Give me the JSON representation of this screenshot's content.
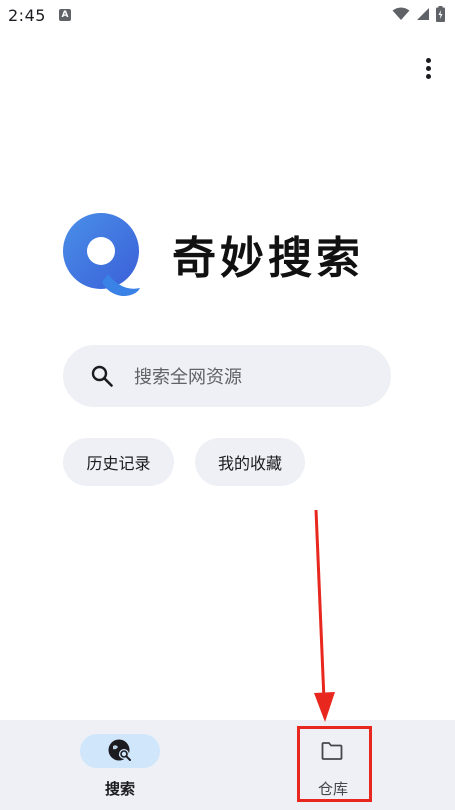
{
  "status_bar": {
    "time": "2:45",
    "notification_icon": "a-letter-icon",
    "icons": [
      "wifi-icon",
      "signal-icon",
      "battery-icon"
    ]
  },
  "header": {
    "menu_icon": "more-vertical-icon"
  },
  "app": {
    "logo_icon": "qimiao-logo-icon",
    "title": "奇妙搜索"
  },
  "search": {
    "icon": "search-icon",
    "placeholder": "搜索全网资源"
  },
  "quick_links": [
    {
      "label": "历史记录"
    },
    {
      "label": "我的收藏"
    }
  ],
  "bottom_nav": {
    "items": [
      {
        "label": "搜索",
        "icon": "globe-search-icon",
        "selected": true
      },
      {
        "label": "仓库",
        "icon": "folder-icon",
        "selected": false
      }
    ]
  },
  "colors": {
    "accent_light": "#cfe6fb",
    "surface": "#eef0f5",
    "logo_blue": "#3b6fe0",
    "annotation_red": "#e8281e"
  }
}
